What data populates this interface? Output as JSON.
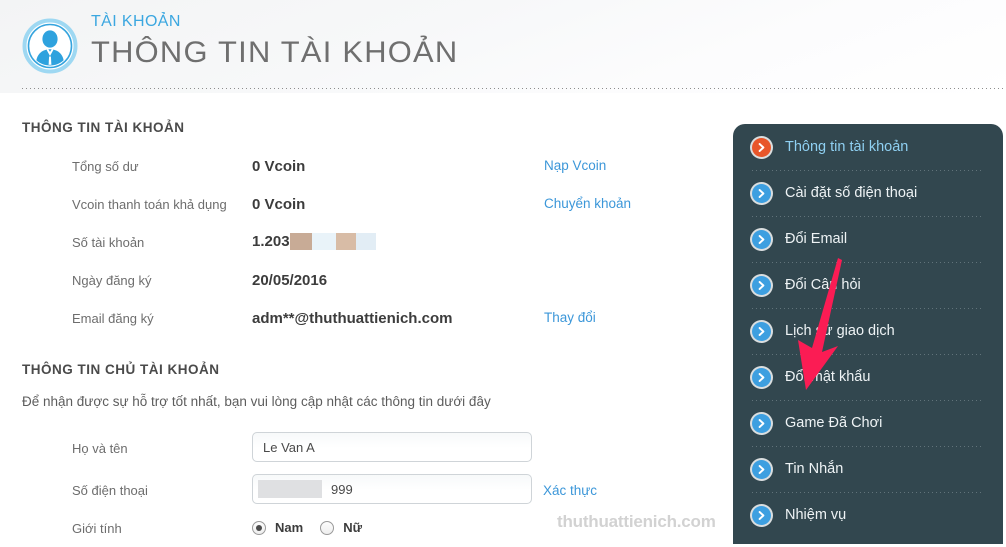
{
  "header": {
    "kicker": "TÀI KHOẢN",
    "title": "THÔNG TIN TÀI KHOẢN",
    "avatar_icon": "user-avatar-icon",
    "accent_color": "#3ba7e0",
    "title_color": "#6f6f6f"
  },
  "account_section": {
    "heading": "THÔNG TIN TÀI KHOẢN",
    "rows": [
      {
        "label": "Tổng số dư",
        "value": "0 Vcoin",
        "action": "Nạp Vcoin",
        "masked": false
      },
      {
        "label": "Vcoin thanh toán khả dụng",
        "value": "0 Vcoin",
        "action": "Chuyển khoản",
        "masked": false
      },
      {
        "label": "Số tài khoản",
        "value": "1.203",
        "action": "",
        "masked": true
      },
      {
        "label": "Ngày đăng ký",
        "value": "20/05/2016",
        "action": "",
        "masked": false
      },
      {
        "label": "Email đăng ký",
        "value": "adm**@thuthuattienich.com",
        "action": "Thay đổi",
        "masked": false
      }
    ]
  },
  "owner_section": {
    "heading": "THÔNG TIN CHỦ TÀI KHOẢN",
    "note": "Để nhận được sự hỗ trợ tốt nhất, bạn vui lòng cập nhật các thông tin dưới đây",
    "fields": {
      "fullname": {
        "label": "Họ và tên",
        "value": "Le Van A",
        "placeholder": ""
      },
      "phone": {
        "label": "Số điện thoại",
        "value": "999",
        "placeholder": "",
        "action": "Xác thực"
      },
      "gender": {
        "label": "Giới tính",
        "options": [
          {
            "label": "Nam",
            "checked": true
          },
          {
            "label": "Nữ",
            "checked": false
          }
        ]
      }
    }
  },
  "sidebar": {
    "background_color": "#32474f",
    "active_icon_color": "#e8562a",
    "icon_color": "#3d9fe0",
    "items": [
      {
        "label": "Thông tin tài khoản",
        "icon": "chevron-right-circle-icon",
        "active": true
      },
      {
        "label": "Cài đặt số điện thoại",
        "icon": "chevron-right-circle-icon",
        "active": false
      },
      {
        "label": "Đổi Email",
        "icon": "chevron-right-circle-icon",
        "active": false
      },
      {
        "label": "Đổi Câu hỏi",
        "icon": "chevron-right-circle-icon",
        "active": false
      },
      {
        "label": "Lịch sử giao dịch",
        "icon": "chevron-right-circle-icon",
        "active": false
      },
      {
        "label": "Đổi mật khẩu",
        "icon": "chevron-right-circle-icon",
        "active": false
      },
      {
        "label": "Game Đã Chơi",
        "icon": "chevron-right-circle-icon",
        "active": false
      },
      {
        "label": "Tin Nhắn",
        "icon": "chevron-right-circle-icon",
        "active": false
      },
      {
        "label": "Nhiệm vụ",
        "icon": "chevron-right-circle-icon",
        "active": false
      }
    ]
  },
  "annotation": {
    "arrow_color": "#fb1c54",
    "points_to": "Đổi mật khẩu"
  },
  "watermark": {
    "text": "thuthuattienich.com"
  }
}
